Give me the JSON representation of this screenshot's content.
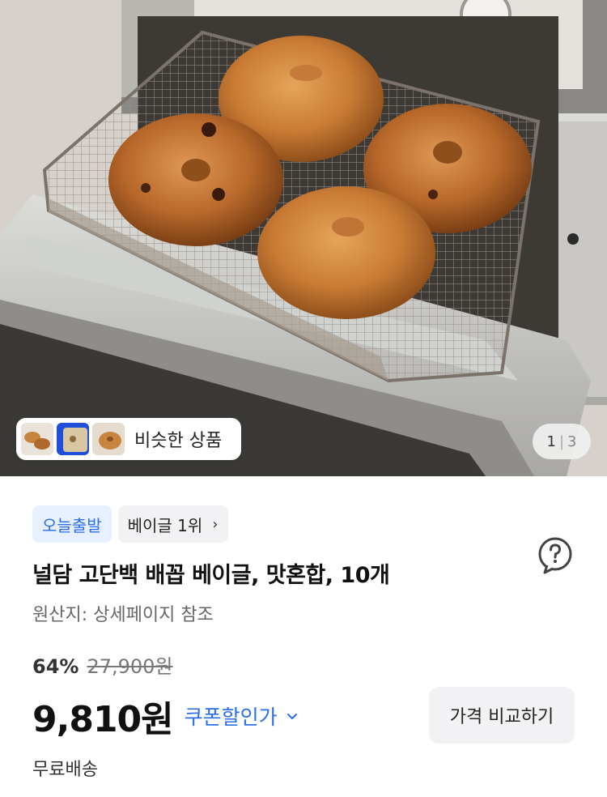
{
  "similar_products": {
    "label": "비슷한 상품"
  },
  "image_pager": {
    "current": "1",
    "separator": "|",
    "total": "3"
  },
  "badges": {
    "delivery": "오늘출발",
    "rank": "베이글 1위",
    "rank_chevron": "›"
  },
  "product": {
    "title": "널담 고단백 배꼽 베이글, 맛혼합, 10개",
    "origin": "원산지: 상세페이지 참조"
  },
  "pricing": {
    "discount_rate": "64%",
    "original_price": "27,900원",
    "price": "9,810원",
    "coupon_label": "쿠폰할인가",
    "compare_button": "가격 비교하기",
    "shipping": "무료배송"
  },
  "colors": {
    "accent": "#2b6ee8",
    "badge_bg": "#e6f0ff",
    "chip_bg": "#f2f2f4"
  },
  "icons": {
    "help": "question-circle-icon",
    "coupon": "chevron-down-icon",
    "rank": "chevron-right-icon"
  }
}
